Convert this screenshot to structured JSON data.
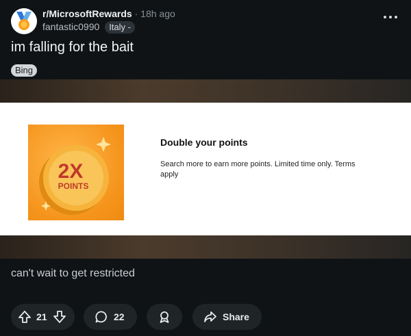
{
  "post": {
    "subreddit": "r/MicrosoftRewards",
    "separator": "·",
    "age": "18h ago",
    "author": "fantastic0990",
    "author_flair": "Italy -",
    "title": "im falling for the bait",
    "post_flair": "Bing",
    "body": "can't wait to get restricted"
  },
  "image": {
    "badge_big": "2X",
    "badge_small": "POINTS",
    "heading": "Double your points",
    "description": "Search more to earn more points. Limited time only. Terms apply"
  },
  "actions": {
    "score": "21",
    "comments": "22",
    "share_label": "Share"
  },
  "colors": {
    "background": "#0f1316",
    "pill": "#1f2427",
    "promo_orange": "#f5941c"
  },
  "icons": [
    "medal-icon",
    "more-icon",
    "upvote-icon",
    "downvote-icon",
    "comment-icon",
    "award-icon",
    "share-icon"
  ]
}
